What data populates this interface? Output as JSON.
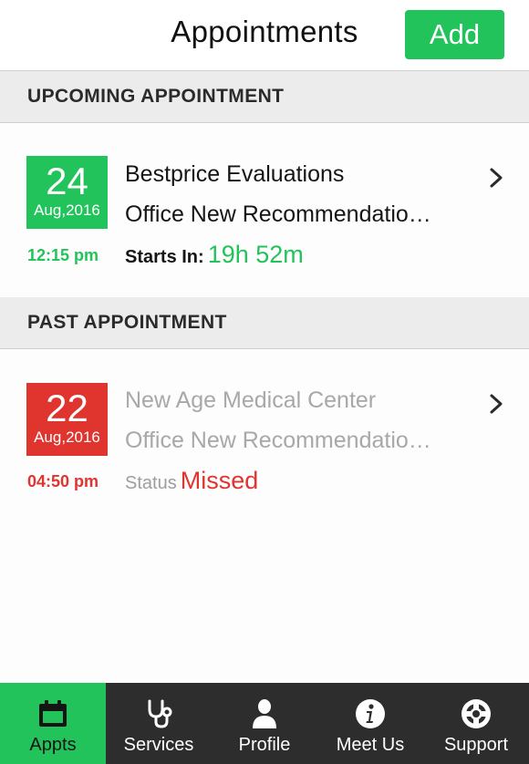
{
  "header": {
    "title": "Appointments",
    "add_label": "Add"
  },
  "upcoming": {
    "section_label": "UPCOMING APPOINTMENT",
    "item": {
      "day": "24",
      "month_year": "Aug,2016",
      "time": "12:15 pm",
      "provider": "Bestprice Evaluations",
      "description": "Office New Recommendatio…",
      "starts_label": "Starts In:",
      "starts_value": "19h 52m"
    }
  },
  "past": {
    "section_label": "PAST APPOINTMENT",
    "item": {
      "day": "22",
      "month_year": "Aug,2016",
      "time": "04:50 pm",
      "provider": "New Age Medical Center",
      "description": "Office New Recommendatio…",
      "status_label": "Status",
      "status_value": "Missed"
    }
  },
  "tabs": [
    {
      "label": "Appts",
      "icon": "calendar-icon",
      "active": true
    },
    {
      "label": "Services",
      "icon": "stethoscope-icon",
      "active": false
    },
    {
      "label": "Profile",
      "icon": "person-icon",
      "active": false
    },
    {
      "label": "Meet Us",
      "icon": "info-icon",
      "active": false
    },
    {
      "label": "Support",
      "icon": "lifebuoy-icon",
      "active": false
    }
  ],
  "colors": {
    "accent_green": "#22c35b",
    "missed_red": "#e0342f",
    "tabbar_bg": "#2e2d2d",
    "section_bg": "#ececec"
  }
}
